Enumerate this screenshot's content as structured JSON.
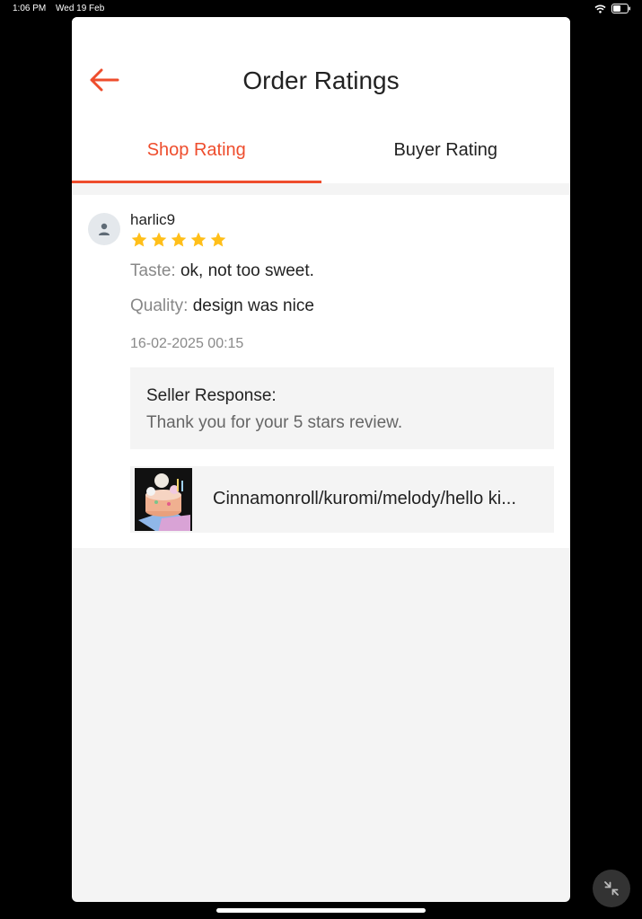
{
  "status_bar": {
    "time": "1:06 PM",
    "date": "Wed 19 Feb"
  },
  "header": {
    "title": "Order Ratings",
    "back_icon": "arrow-left-icon"
  },
  "tabs": [
    {
      "label": "Shop Rating",
      "active": true
    },
    {
      "label": "Buyer Rating",
      "active": false
    }
  ],
  "review": {
    "username": "harlic9",
    "stars": 5,
    "taste_label": "Taste:",
    "taste_value": "ok, not too sweet.",
    "quality_label": "Quality:",
    "quality_value": "design was nice",
    "date": "16-02-2025 00:15",
    "seller_response_title": "Seller Response:",
    "seller_response_text": "Thank you for your 5 stars review.",
    "product_name": "Cinnamonroll/kuromi/melody/hello ki..."
  },
  "colors": {
    "accent": "#ee4d2d",
    "star": "#ffbf1a",
    "background": "#f4f4f4"
  }
}
